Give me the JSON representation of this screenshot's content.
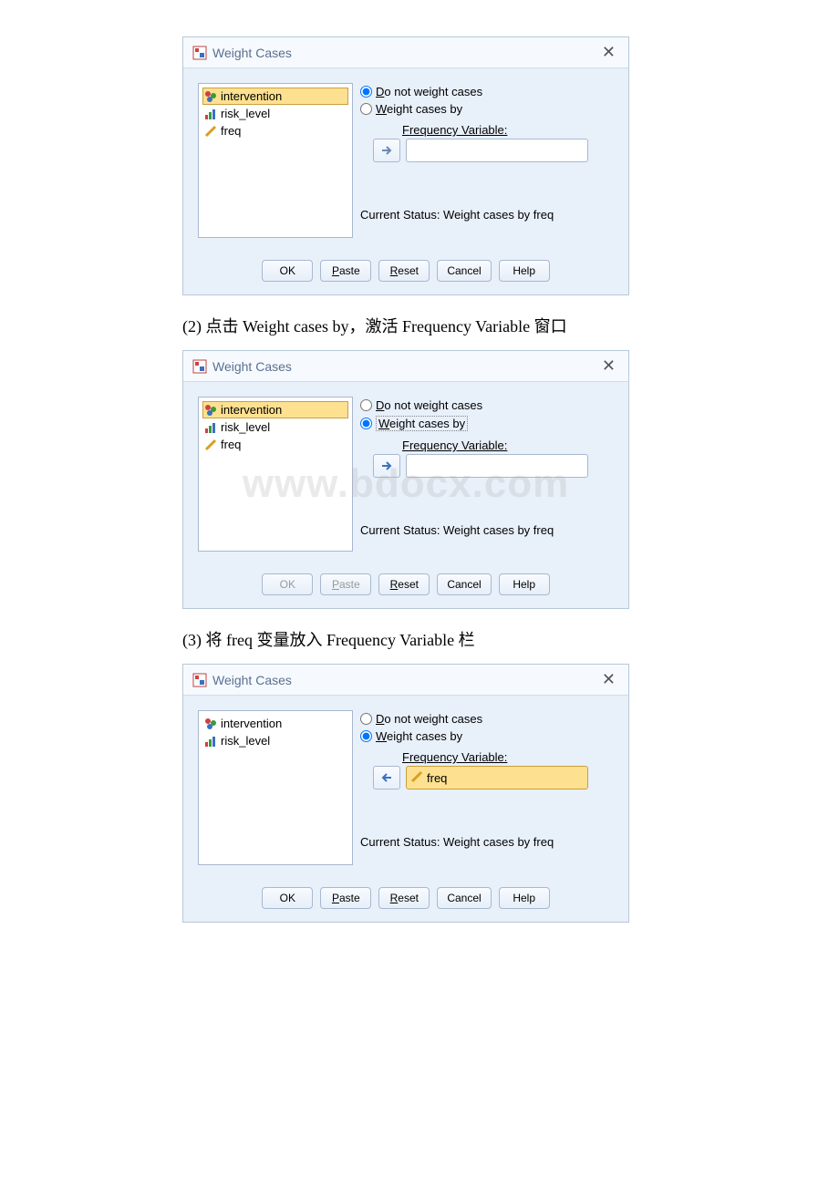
{
  "shared": {
    "title": "Weight Cases",
    "radio1": "Do not weight cases",
    "radio1_u": "D",
    "radio2": "Weight cases by",
    "radio2_u": "W",
    "freq_label": "Frequency Variable:",
    "freq_u": "F",
    "status": "Current Status: Weight cases by freq",
    "ok": "OK",
    "paste": "Paste",
    "paste_u": "P",
    "reset": "Reset",
    "reset_u": "R",
    "cancel": "Cancel",
    "help": "Help"
  },
  "dialog1": {
    "vars": [
      "intervention",
      "risk_level",
      "freq"
    ],
    "selected": "donot"
  },
  "dialog2": {
    "vars": [
      "intervention",
      "risk_level",
      "freq"
    ],
    "selected": "weight",
    "ok_disabled": true
  },
  "dialog3": {
    "vars": [
      "intervention",
      "risk_level"
    ],
    "selected": "weight",
    "freqvar": "freq"
  },
  "caption2": "(2) 点击 Weight cases by，激活 Frequency Variable 窗口",
  "caption3": "(3) 将 freq 变量放入 Frequency Variable 栏"
}
